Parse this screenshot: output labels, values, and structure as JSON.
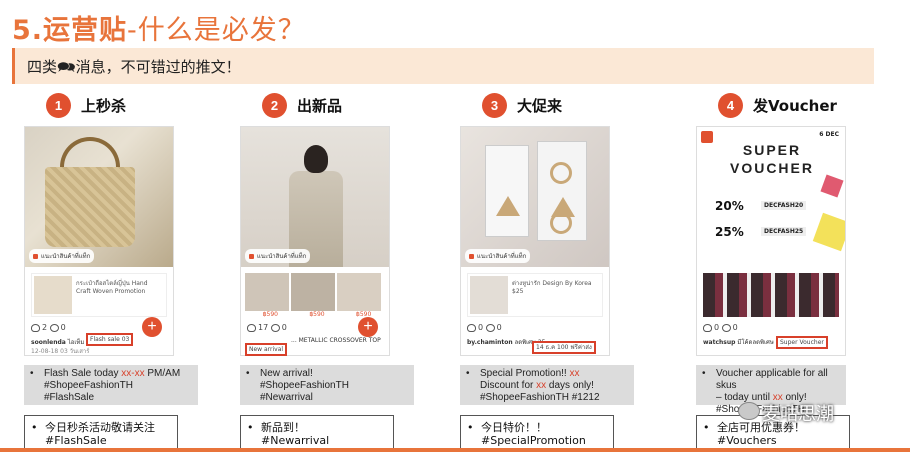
{
  "page": {
    "title_num": "5.运营贴",
    "title_rest": "-什么是必发？",
    "subtitle": "四类🗪消息，不可错过的推文！"
  },
  "columns": [
    {
      "num": "1",
      "label": "上秒杀",
      "tag": "แนะนำสินค้าที่แท็ก",
      "prod_text": "กระเป๋าถือสไตล์ญี่ปุ่น Hand Craft Woven Promotion",
      "likes": "2",
      "comments": "0",
      "user": "soonlenda",
      "cap_pre": "ไอเท็ม",
      "highlight": "Flash sale 03",
      "date": "12-08-18 03 วันเสาร์",
      "promo_pre": "Flash Sale today ",
      "promo_red": "xx-xx",
      "promo_post": " PM/AM",
      "promo_l2": "#ShopeeFashionTH",
      "promo_l3": "#FlashSale",
      "cn_l1": "今日秒杀活动敬请关注",
      "cn_l2": "#FlashSale"
    },
    {
      "num": "2",
      "label": "出新品",
      "tag": "แนะนำสินค้าที่แท็ก",
      "prices": [
        "฿590",
        "฿590",
        "฿590"
      ],
      "likes": "17",
      "comments": "0",
      "user": "",
      "cap_pre": "... METALLIC CROSSOVER TOP",
      "highlight": "New arrival",
      "date": "",
      "promo_l1": "New arrival!",
      "promo_l2": "#ShopeeFashionTH",
      "promo_l3": "#Newarrival",
      "cn_l1": "新品到！",
      "cn_l2": "#Newarrival"
    },
    {
      "num": "3",
      "label": "大促来",
      "tag": "แนะนำสินค้าที่แท็ก",
      "prod_text": "ต่างหูน่ารัก Design By Korea",
      "prod_price": "$25",
      "likes": "0",
      "comments": "0",
      "user": "by.chaminton",
      "cap_pre": "ลดพิเศษ 25",
      "highlight": "14 ธ.ค 100 ฟรีค่าส่ง",
      "date": "",
      "promo_pre": "Special Promotion!! ",
      "promo_red": "xx",
      "promo_l2_pre": "Discount for ",
      "promo_l2_red": "xx",
      "promo_l2_post": " days only!",
      "promo_l3": "#ShopeeFashionTH #1212",
      "cn_l1": "今日特价！！",
      "cn_l2": "#SpecialPromotion #1212"
    },
    {
      "num": "4",
      "label": "发Voucher",
      "tag": "",
      "v_title": "SUPER VOUCHER",
      "v_dec": "6 DEC",
      "v_pct1": "20%",
      "v_code1": "DECFASH20",
      "v_pct2": "25%",
      "v_code2": "DECFASH25",
      "likes": "0",
      "comments": "0",
      "user": "watchsup",
      "cap_pre": "มีโค้ดลดพิเศษ",
      "highlight": "Super Voucher",
      "date": "",
      "promo_l1": "Voucher applicable for all skus",
      "promo_l2_pre": "– today until ",
      "promo_l2_red": "xx",
      "promo_l2_post": " only!",
      "promo_l3": "#ShopeeFashionTH",
      "cn_l1": "全店可用优惠券！",
      "cn_l2": "#Vouchers"
    }
  ],
  "watermark": "麦咕思潮",
  "colors": {
    "accent": "#e8743b",
    "red": "#d8402a",
    "band": "#fbe8d6"
  }
}
